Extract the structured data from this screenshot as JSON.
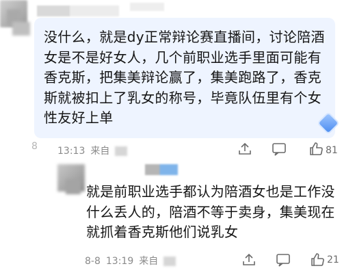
{
  "comment1": {
    "text": "没什么，就是dy正常辩论赛直播间，讨论陪酒女是不是好女人，几个前职业选手里面可能有香克斯，把集美辩论赢了，集美跑路了，香克斯就被扣上了乳女的称号，毕竟队伍里有个女性友好上单",
    "time": "13:13",
    "source": "来自",
    "left_fragment": "8",
    "like_count": "81"
  },
  "comment2": {
    "text": "就是前职业选手都认为陪酒女也是工作没什么丢人的，陪酒不等于卖身，集美现在就抓着香克斯他们说乳女",
    "date": "8-8",
    "time": "13:19",
    "source": "来自",
    "like_count": "21"
  },
  "icons": {
    "share": "share-icon",
    "comment": "comment-icon",
    "like": "thumbs-up-icon",
    "badge": "diamond-badge-icon"
  },
  "colors": {
    "bubble": "#eef4ff",
    "meta": "#8a8a8a",
    "icon": "#6a6a6a"
  }
}
